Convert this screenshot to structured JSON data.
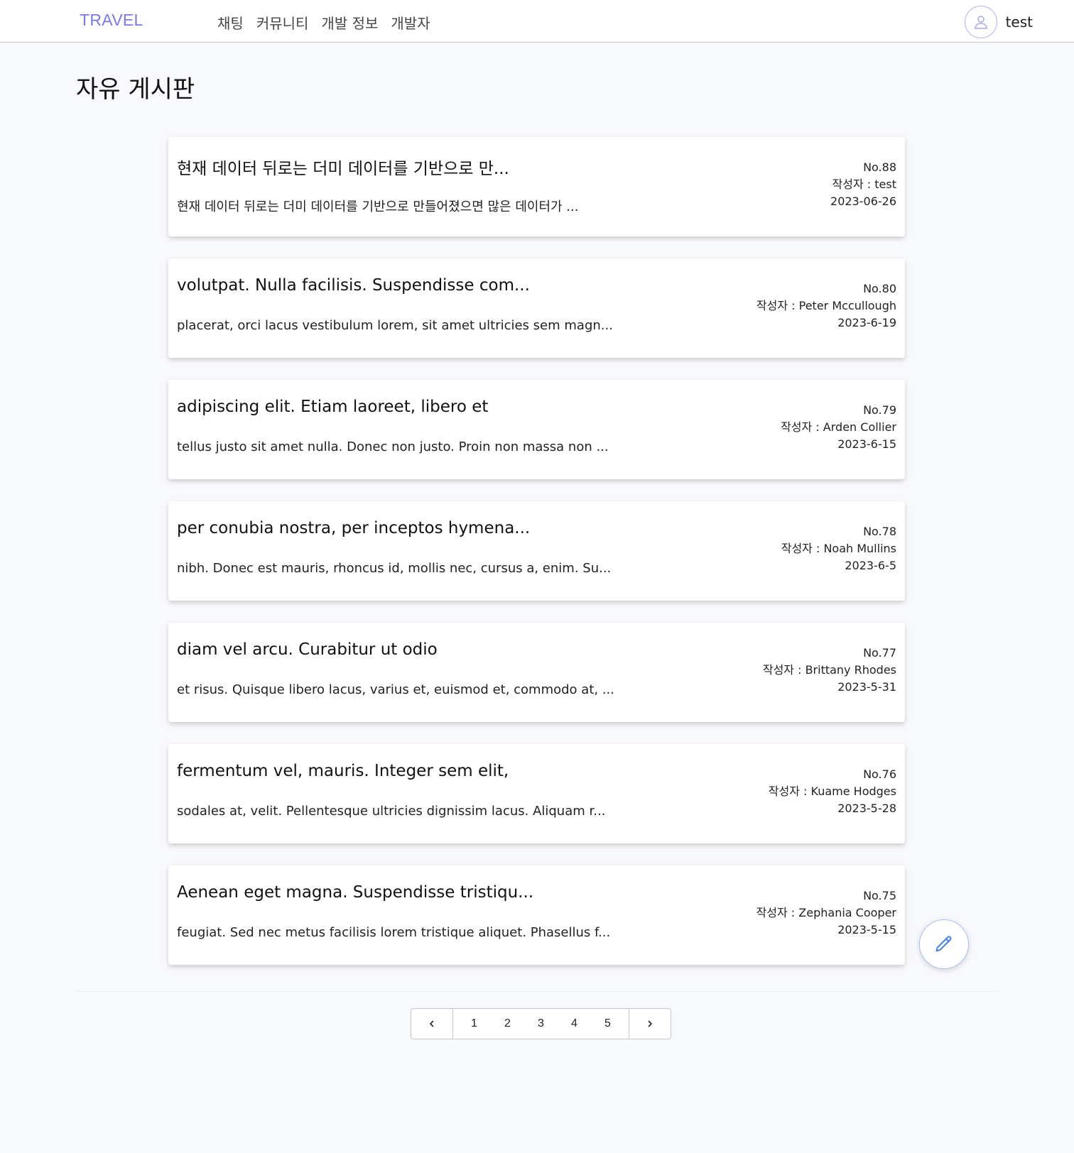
{
  "header": {
    "logo": "TRAVEL",
    "nav": [
      "채팅",
      "커뮤니티",
      "개발 정보",
      "개발자"
    ],
    "user": {
      "name": "test",
      "icon": "user-icon"
    }
  },
  "page": {
    "title": "자유 게시판"
  },
  "posts": [
    {
      "title": "현재 데이터 뒤로는 더미 데이터를 기반으로 만...",
      "excerpt": "현재 데이터 뒤로는 더미 데이터를 기반으로 만들어졌으면 많은 데이터가 ...",
      "number": "No.88",
      "author": "작성자 : test",
      "date": "2023-06-26"
    },
    {
      "title": "volutpat. Nulla facilisis. Suspendisse com...",
      "excerpt": "placerat, orci lacus vestibulum lorem, sit amet ultricies sem magn...",
      "number": "No.80",
      "author": "작성자 : Peter Mccullough",
      "date": "2023-6-19"
    },
    {
      "title": "adipiscing elit. Etiam laoreet, libero et",
      "excerpt": "tellus justo sit amet nulla. Donec non justo. Proin non massa non ...",
      "number": "No.79",
      "author": "작성자 : Arden Collier",
      "date": "2023-6-15"
    },
    {
      "title": "per conubia nostra, per inceptos hymena...",
      "excerpt": "nibh. Donec est mauris, rhoncus id, mollis nec, cursus a, enim. Su...",
      "number": "No.78",
      "author": "작성자 : Noah Mullins",
      "date": "2023-6-5"
    },
    {
      "title": "diam vel arcu. Curabitur ut odio",
      "excerpt": "et risus. Quisque libero lacus, varius et, euismod et, commodo at, ...",
      "number": "No.77",
      "author": "작성자 : Brittany Rhodes",
      "date": "2023-5-31"
    },
    {
      "title": "fermentum vel, mauris. Integer sem elit,",
      "excerpt": "sodales at, velit. Pellentesque ultricies dignissim lacus. Aliquam r...",
      "number": "No.76",
      "author": "작성자 : Kuame Hodges",
      "date": "2023-5-28"
    },
    {
      "title": "Aenean eget magna. Suspendisse tristiqu...",
      "excerpt": "feugiat. Sed nec metus facilisis lorem tristique aliquet. Phasellus f...",
      "number": "No.75",
      "author": "작성자 : Zephania Cooper",
      "date": "2023-5-15"
    }
  ],
  "write_button": {
    "icon": "pencil-icon"
  },
  "pagination": {
    "prev_icon": "chevron-left-icon",
    "next_icon": "chevron-right-icon",
    "pages": [
      "1",
      "2",
      "3",
      "4",
      "5"
    ]
  },
  "colors": {
    "brand": "#7b79ea",
    "background": "#f8f9fc",
    "fab_border": "#a6c3f0"
  }
}
